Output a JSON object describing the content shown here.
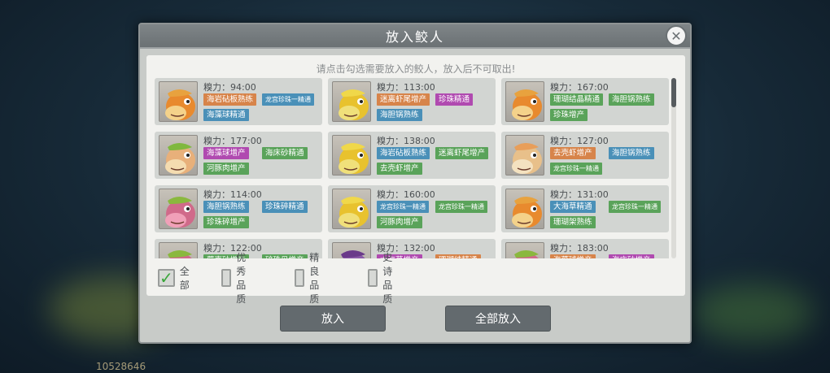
{
  "background": {
    "score": "10528646"
  },
  "dialog": {
    "title": "放入鲛人",
    "close_icon": "✕",
    "hint": "请点击勾选需要放入的鲛人，放入后不可取出!",
    "mermaids": [
      {
        "power": "糗力：94:00",
        "fish": "orange",
        "tags": [
          {
            "text": "海岩砧板熟练",
            "color": "orange"
          },
          {
            "text": "龙宫珍珠一精通",
            "color": "blue",
            "small": true
          },
          {
            "text": "海藻球精通",
            "color": "blue"
          }
        ]
      },
      {
        "power": "糗力：113:00",
        "fish": "yellow",
        "tags": [
          {
            "text": "迷离虾尾增产",
            "color": "orange"
          },
          {
            "text": "珍珠精通",
            "color": "purple"
          },
          {
            "text": "海胆锅熟练",
            "color": "blue"
          }
        ]
      },
      {
        "power": "糗力：167:00",
        "fish": "orange",
        "tags": [
          {
            "text": "珊瑚结晶精通",
            "color": "green"
          },
          {
            "text": "海胆锅熟练",
            "color": "green"
          },
          {
            "text": "珍珠增产",
            "color": "green"
          }
        ]
      },
      {
        "power": "糗力：177:00",
        "fish": "leaf",
        "tags": [
          {
            "text": "海藻球增产",
            "color": "purple"
          },
          {
            "text": "海床砂精通",
            "color": "green"
          },
          {
            "text": "河豚肉增产",
            "color": "green"
          }
        ]
      },
      {
        "power": "糗力：138:00",
        "fish": "yellow",
        "tags": [
          {
            "text": "海岩砧板熟练",
            "color": "blue"
          },
          {
            "text": "迷离虾尾增产",
            "color": "green"
          },
          {
            "text": "去壳虾增产",
            "color": "green"
          }
        ]
      },
      {
        "power": "糗力：127:00",
        "fish": "cream",
        "tags": [
          {
            "text": "去壳虾增产",
            "color": "orange"
          },
          {
            "text": "海胆锅熟练",
            "color": "blue"
          },
          {
            "text": "龙宫珍珠一精通",
            "color": "green",
            "small": true
          }
        ]
      },
      {
        "power": "糗力：114:00",
        "fish": "pink",
        "tags": [
          {
            "text": "海胆锅熟练",
            "color": "blue"
          },
          {
            "text": "珍珠碎精通",
            "color": "blue"
          },
          {
            "text": "珍珠碎增产",
            "color": "green"
          }
        ]
      },
      {
        "power": "糗力：160:00",
        "fish": "yellow",
        "tags": [
          {
            "text": "龙宫珍珠一精通",
            "color": "blue",
            "small": true
          },
          {
            "text": "龙宫珍珠一精通",
            "color": "green",
            "small": true
          },
          {
            "text": "河豚肉增产",
            "color": "green"
          }
        ]
      },
      {
        "power": "糗力：131:00",
        "fish": "orange",
        "tags": [
          {
            "text": "大海草精通",
            "color": "blue"
          },
          {
            "text": "龙宫珍珠一精通",
            "color": "green",
            "small": true
          },
          {
            "text": "珊瑚架熟练",
            "color": "green"
          }
        ]
      },
      {
        "power": "糗力：122:00",
        "fish": "pink",
        "tags": [
          {
            "text": "蘑壳砂增产",
            "color": "green"
          },
          {
            "text": "碎珠贝增产",
            "color": "green"
          }
        ]
      },
      {
        "power": "糗力：132:00",
        "fish": "purple",
        "tags": [
          {
            "text": "大海草增产",
            "color": "purple"
          },
          {
            "text": "珊瑚结精通",
            "color": "orange"
          }
        ]
      },
      {
        "power": "糗力：183:00",
        "fish": "pink",
        "tags": [
          {
            "text": "海藻球增产",
            "color": "orange"
          },
          {
            "text": "海床砂增产",
            "color": "purple"
          }
        ]
      }
    ],
    "filters": [
      {
        "label": "全部",
        "checked": true
      },
      {
        "label": "优秀品质",
        "checked": false
      },
      {
        "label": "精良品质",
        "checked": false
      },
      {
        "label": "史诗品质",
        "checked": false
      }
    ],
    "check_mark": "✓",
    "put_in_button": "放入",
    "put_all_button": "全部放入"
  }
}
